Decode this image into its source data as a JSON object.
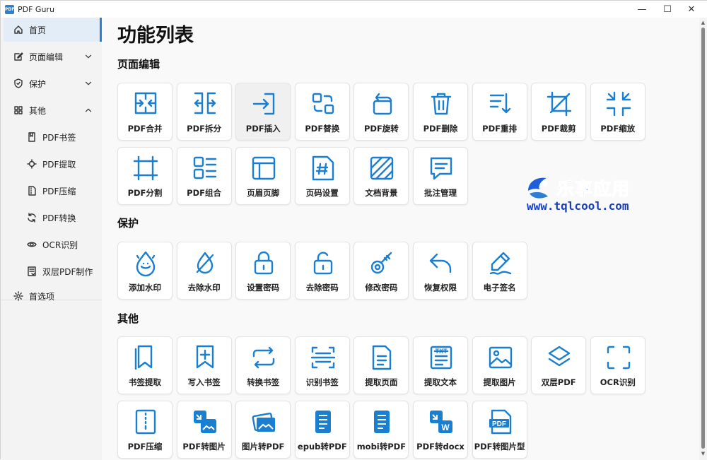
{
  "window": {
    "title": "PDF Guru",
    "logo_text": "PDF",
    "controls": {
      "minimize": "—",
      "maximize": "☐",
      "close": "✕"
    }
  },
  "sidebar": {
    "items": [
      {
        "label": "首页",
        "icon": "home-icon",
        "active": true
      },
      {
        "label": "页面编辑",
        "icon": "edit-icon",
        "expandable": true,
        "expanded": false
      },
      {
        "label": "保护",
        "icon": "shield-icon",
        "expandable": true,
        "expanded": false
      },
      {
        "label": "其他",
        "icon": "grid-icon",
        "expandable": true,
        "expanded": true
      },
      {
        "label": "PDF书签",
        "icon": "bookmark-doc-icon",
        "sub": true
      },
      {
        "label": "PDF提取",
        "icon": "target-icon",
        "sub": true
      },
      {
        "label": "PDF压缩",
        "icon": "zip-doc-icon",
        "sub": true
      },
      {
        "label": "PDF转换",
        "icon": "refresh-icon",
        "sub": true
      },
      {
        "label": "OCR识别",
        "icon": "eye-icon",
        "sub": true
      },
      {
        "label": "双层PDF制作",
        "icon": "layer-doc-icon",
        "sub": true
      },
      {
        "label": "首选项",
        "icon": "gear-icon"
      }
    ]
  },
  "main": {
    "title": "功能列表",
    "sections": [
      {
        "title": "页面编辑",
        "tiles": [
          {
            "label": "PDF合并",
            "icon": "merge-icon"
          },
          {
            "label": "PDF拆分",
            "icon": "split-icon"
          },
          {
            "label": "PDF插入",
            "icon": "insert-icon"
          },
          {
            "label": "PDF替换",
            "icon": "replace-icon"
          },
          {
            "label": "PDF旋转",
            "icon": "rotate-icon"
          },
          {
            "label": "PDF删除",
            "icon": "trash-icon"
          },
          {
            "label": "PDF重排",
            "icon": "sort-icon"
          },
          {
            "label": "PDF裁剪",
            "icon": "crop-icon"
          },
          {
            "label": "PDF缩放",
            "icon": "shrink-icon"
          },
          {
            "label": "PDF分割",
            "icon": "frame-icon"
          },
          {
            "label": "PDF组合",
            "icon": "layout-icon"
          },
          {
            "label": "页眉页脚",
            "icon": "header-footer-icon"
          },
          {
            "label": "页码设置",
            "icon": "page-number-icon"
          },
          {
            "label": "文档背景",
            "icon": "background-icon"
          },
          {
            "label": "批注管理",
            "icon": "comment-icon"
          }
        ]
      },
      {
        "title": "保护",
        "tiles": [
          {
            "label": "添加水印",
            "icon": "watermark-icon"
          },
          {
            "label": "去除水印",
            "icon": "remove-watermark-icon"
          },
          {
            "label": "设置密码",
            "icon": "lock-icon"
          },
          {
            "label": "去除密码",
            "icon": "unlock-icon"
          },
          {
            "label": "修改密码",
            "icon": "key-icon"
          },
          {
            "label": "恢复权限",
            "icon": "undo-icon"
          },
          {
            "label": "电子签名",
            "icon": "signature-icon"
          }
        ]
      },
      {
        "title": "其他",
        "tiles": [
          {
            "label": "书签提取",
            "icon": "bookmarks-icon"
          },
          {
            "label": "写入书签",
            "icon": "add-bookmark-icon"
          },
          {
            "label": "转换书签",
            "icon": "convert-icon"
          },
          {
            "label": "识别书签",
            "icon": "scan-icon"
          },
          {
            "label": "提取页面",
            "icon": "page-icon"
          },
          {
            "label": "提取文本",
            "icon": "text-icon"
          },
          {
            "label": "提取图片",
            "icon": "image-icon"
          },
          {
            "label": "双层PDF",
            "icon": "layers-icon"
          },
          {
            "label": "OCR识别",
            "icon": "ocr-icon"
          },
          {
            "label": "PDF压缩",
            "icon": "zip-icon"
          },
          {
            "label": "PDF转图片",
            "icon": "pdf-to-image-icon"
          },
          {
            "label": "图片转PDF",
            "icon": "image-to-pdf-icon"
          },
          {
            "label": "epub转PDF",
            "icon": "epub-icon"
          },
          {
            "label": "mobi转PDF",
            "icon": "mobi-icon"
          },
          {
            "label": "PDF转docx",
            "icon": "pdf-to-docx-icon"
          },
          {
            "label": "PDF转图片型",
            "icon": "pdf-to-image-type-icon"
          }
        ]
      }
    ]
  },
  "watermark": {
    "text_cn": "乐享应用",
    "url": "www.tqlcool.com"
  },
  "colors": {
    "accent": "#2d7fd3",
    "icon": "#1a7fd0",
    "tile_bg": "#ffffff",
    "sidebar_bg": "#f3f3f3"
  }
}
